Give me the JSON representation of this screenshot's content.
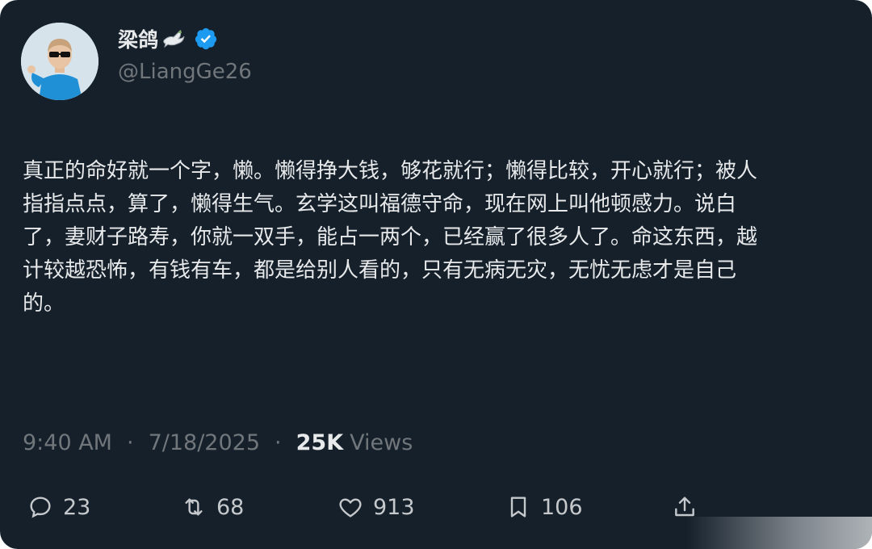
{
  "author": {
    "display_name": "梁鸽",
    "handle": "@LiangGe26",
    "verified": true,
    "name_emoji": "dove-icon"
  },
  "tweet": {
    "text": "真正的命好就一个字，懒。懒得挣大钱，够花就行；懒得比较，开心就行；被人\n指指点点，算了，懒得生气。玄学这叫福德守命，现在网上叫他顿感力。说白\n了，妻财子路寿，你就一双手，能占一两个，已经赢了很多人了。命这东西，越\n计较越恐怖，有钱有车，都是给别人看的，只有无病无灾，无忧无虑才是自己\n的。"
  },
  "meta": {
    "time": "9:40 AM",
    "separator": "·",
    "date": "7/18/2025",
    "views_count": "25K",
    "views_label": "Views"
  },
  "actions": {
    "replies": "23",
    "reposts": "68",
    "likes": "913",
    "bookmarks": "106"
  },
  "colors": {
    "background": "#15202b",
    "text_primary": "#e7e9ea",
    "text_secondary": "#71767b",
    "verified_blue": "#1d9bf0"
  }
}
